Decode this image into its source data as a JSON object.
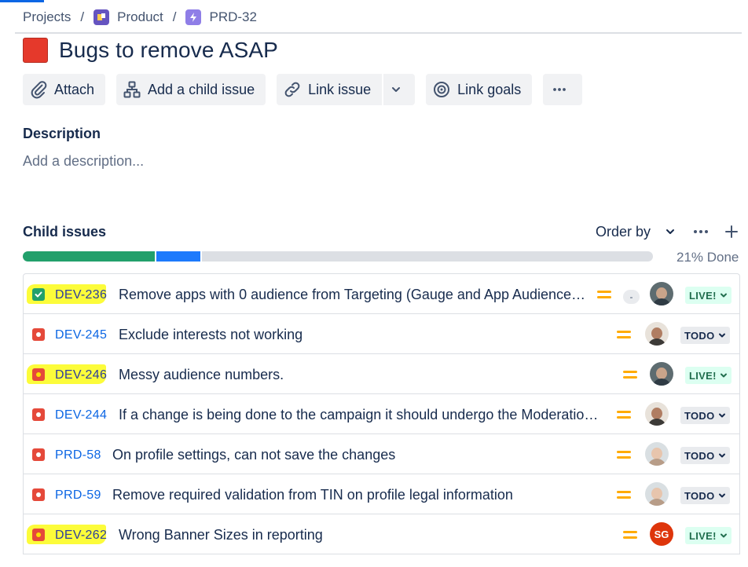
{
  "breadcrumb": {
    "projects": "Projects",
    "separator": "/",
    "product": "Product",
    "issue_key": "PRD-32"
  },
  "issue": {
    "title": "Bugs to remove ASAP"
  },
  "toolbar": {
    "attach": "Attach",
    "add_child": "Add a child issue",
    "link_issue": "Link issue",
    "link_goals": "Link goals"
  },
  "description": {
    "label": "Description",
    "placeholder": "Add a description..."
  },
  "child_issues": {
    "label": "Child issues",
    "order_by": "Order by",
    "progress": {
      "done_fraction": 0.21,
      "in_progress_fraction": 0.07,
      "label": "21% Done"
    },
    "items": [
      {
        "key": "DEV-236",
        "summary": "Remove apps with 0 audience from Targeting (Gauge and App Audience n...",
        "type": "story",
        "highlighted": true,
        "estimate": "-",
        "status": "LIVE!",
        "priority": "medium"
      },
      {
        "key": "DEV-245",
        "summary": "Exclude interests not working",
        "type": "bug",
        "highlighted": false,
        "status": "TODO",
        "priority": "medium"
      },
      {
        "key": "DEV-246",
        "summary": "Messy audience numbers.",
        "type": "bug",
        "highlighted": true,
        "status": "LIVE!",
        "priority": "medium"
      },
      {
        "key": "DEV-244",
        "summary": "If a change is being done to the campaign it should undergo the Moderation ...",
        "type": "bug",
        "highlighted": false,
        "status": "TODO",
        "priority": "medium"
      },
      {
        "key": "PRD-58",
        "summary": "On profile settings, can not save the changes",
        "type": "bug",
        "highlighted": false,
        "status": "TODO",
        "priority": "medium"
      },
      {
        "key": "PRD-59",
        "summary": "Remove required validation from TIN on profile legal information",
        "type": "bug",
        "highlighted": false,
        "status": "TODO",
        "priority": "medium"
      },
      {
        "key": "DEV-262",
        "summary": "Wrong Banner Sizes in reporting",
        "type": "bug",
        "highlighted": true,
        "assignee_initials": "SG",
        "status": "LIVE!",
        "priority": "medium"
      }
    ]
  },
  "colors": {
    "done": "#22a06b",
    "in_progress": "#1d7afc",
    "todo": "#dcdfe4",
    "bug": "#e5493a",
    "highlight": "#fcfc3a",
    "priority_medium": "#ffab00",
    "link": "#0c66e4"
  },
  "icons": {
    "attach": "paperclip-icon",
    "add_child": "hierarchy-icon",
    "link": "link-icon",
    "goals": "target-icon",
    "more": "more-horizontal-icon",
    "add": "plus-icon"
  }
}
